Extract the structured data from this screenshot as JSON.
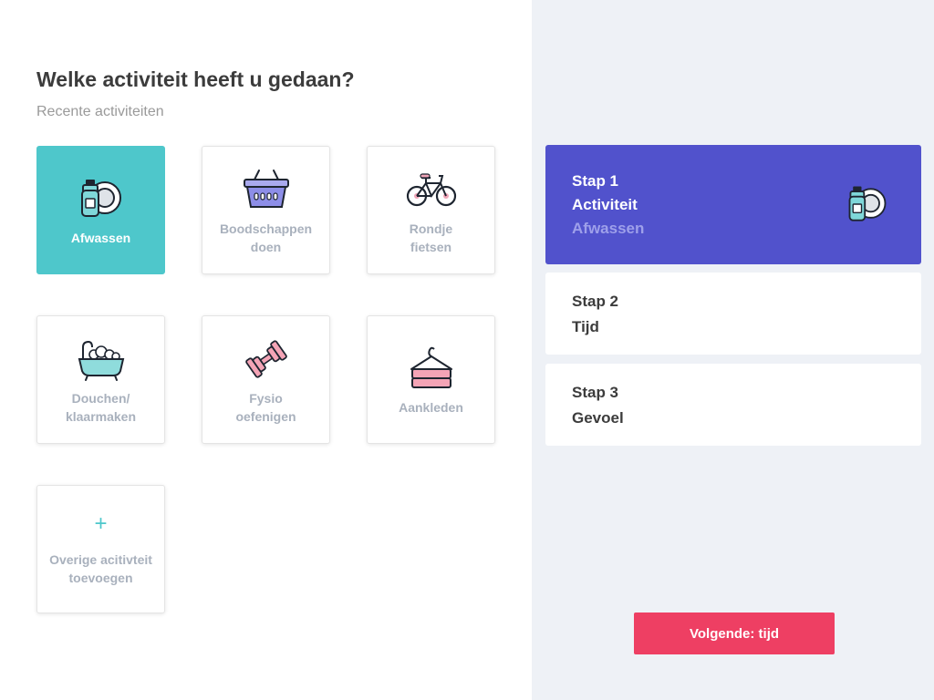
{
  "question": {
    "title": "Welke activiteit heeft u gedaan?",
    "subtitle": "Recente activiteiten"
  },
  "activities": [
    {
      "label": "Afwassen",
      "icon": "dish-soap-plate-icon",
      "selected": true
    },
    {
      "label": "Boodschappen\ndoen",
      "icon": "shopping-basket-icon",
      "selected": false
    },
    {
      "label": "Rondje\nfietsen",
      "icon": "bicycle-icon",
      "selected": false
    },
    {
      "label": "Douchen/\nklaarmaken",
      "icon": "bathtub-icon",
      "selected": false
    },
    {
      "label": "Fysio\noefenigen",
      "icon": "dumbbell-icon",
      "selected": false
    },
    {
      "label": "Aankleden",
      "icon": "towel-hanger-icon",
      "selected": false
    }
  ],
  "add_activity": {
    "symbol": "+",
    "label": "Overige acitivteit\ntoevoegen"
  },
  "steps": [
    {
      "title": "Stap 1",
      "name": "Activiteit",
      "value": "Afwassen",
      "active": true,
      "icon": "dish-soap-plate-icon"
    },
    {
      "title": "Stap 2",
      "name": "Tijd",
      "active": false
    },
    {
      "title": "Stap 3",
      "name": "Gevoel",
      "active": false
    }
  ],
  "next_button": {
    "label": "Volgende: tijd"
  },
  "colors": {
    "selected_tile": "#4ec7cb",
    "active_step": "#5152cc",
    "next_button": "#ee3f63",
    "background": "#eef1f6"
  }
}
